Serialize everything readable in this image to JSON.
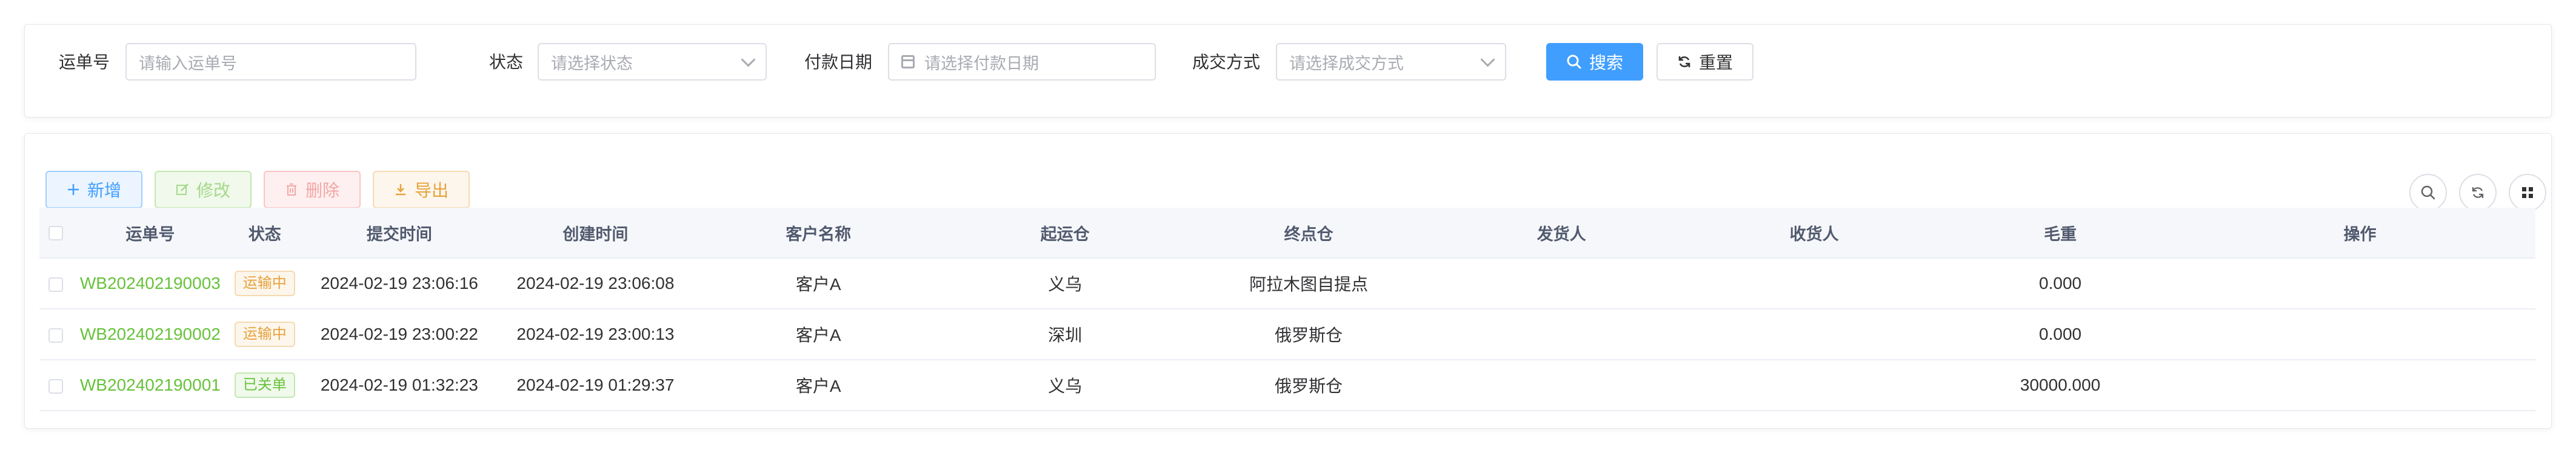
{
  "filters": {
    "waybill": {
      "label": "运单号",
      "placeholder": "请输入运单号"
    },
    "status": {
      "label": "状态",
      "placeholder": "请选择状态"
    },
    "pay_date": {
      "label": "付款日期",
      "placeholder": "请选择付款日期"
    },
    "deal_method": {
      "label": "成交方式",
      "placeholder": "请选择成交方式"
    },
    "search_label": "搜索",
    "reset_label": "重置"
  },
  "toolbar": {
    "add_label": "新增",
    "edit_label": "修改",
    "delete_label": "删除",
    "export_label": "导出"
  },
  "table": {
    "headers": {
      "waybill": "运单号",
      "status": "状态",
      "submit_time": "提交时间",
      "create_time": "创建时间",
      "customer": "客户名称",
      "origin": "起运仓",
      "destination": "终点仓",
      "shipper": "发货人",
      "receiver": "收货人",
      "gross_weight": "毛重",
      "actions": "操作"
    },
    "rows": [
      {
        "waybill": "WB202402190003",
        "status": "运输中",
        "status_type": "transit",
        "submit_time": "2024-02-19 23:06:16",
        "create_time": "2024-02-19 23:06:08",
        "customer": "客户A",
        "origin": "义乌",
        "destination": "阿拉木图自提点",
        "shipper": "",
        "receiver": "",
        "gross_weight": "0.000",
        "actions": ""
      },
      {
        "waybill": "WB202402190002",
        "status": "运输中",
        "status_type": "transit",
        "submit_time": "2024-02-19 23:00:22",
        "create_time": "2024-02-19 23:00:13",
        "customer": "客户A",
        "origin": "深圳",
        "destination": "俄罗斯仓",
        "shipper": "",
        "receiver": "",
        "gross_weight": "0.000",
        "actions": ""
      },
      {
        "waybill": "WB202402190001",
        "status": "已关单",
        "status_type": "closed",
        "submit_time": "2024-02-19 01:32:23",
        "create_time": "2024-02-19 01:29:37",
        "customer": "客户A",
        "origin": "义乌",
        "destination": "俄罗斯仓",
        "shipper": "",
        "receiver": "",
        "gross_weight": "30000.000",
        "actions": ""
      }
    ]
  },
  "colors": {
    "primary": "#409eff",
    "success": "#67c23a",
    "warning": "#e6a23c",
    "danger": "#f56c6c"
  },
  "icons": {
    "search": "search-icon",
    "reset": "refresh-icon",
    "add": "plus-icon",
    "edit": "edit-icon",
    "delete": "trash-icon",
    "export": "download-icon",
    "grid": "grid-icon",
    "calendar": "calendar-icon"
  }
}
